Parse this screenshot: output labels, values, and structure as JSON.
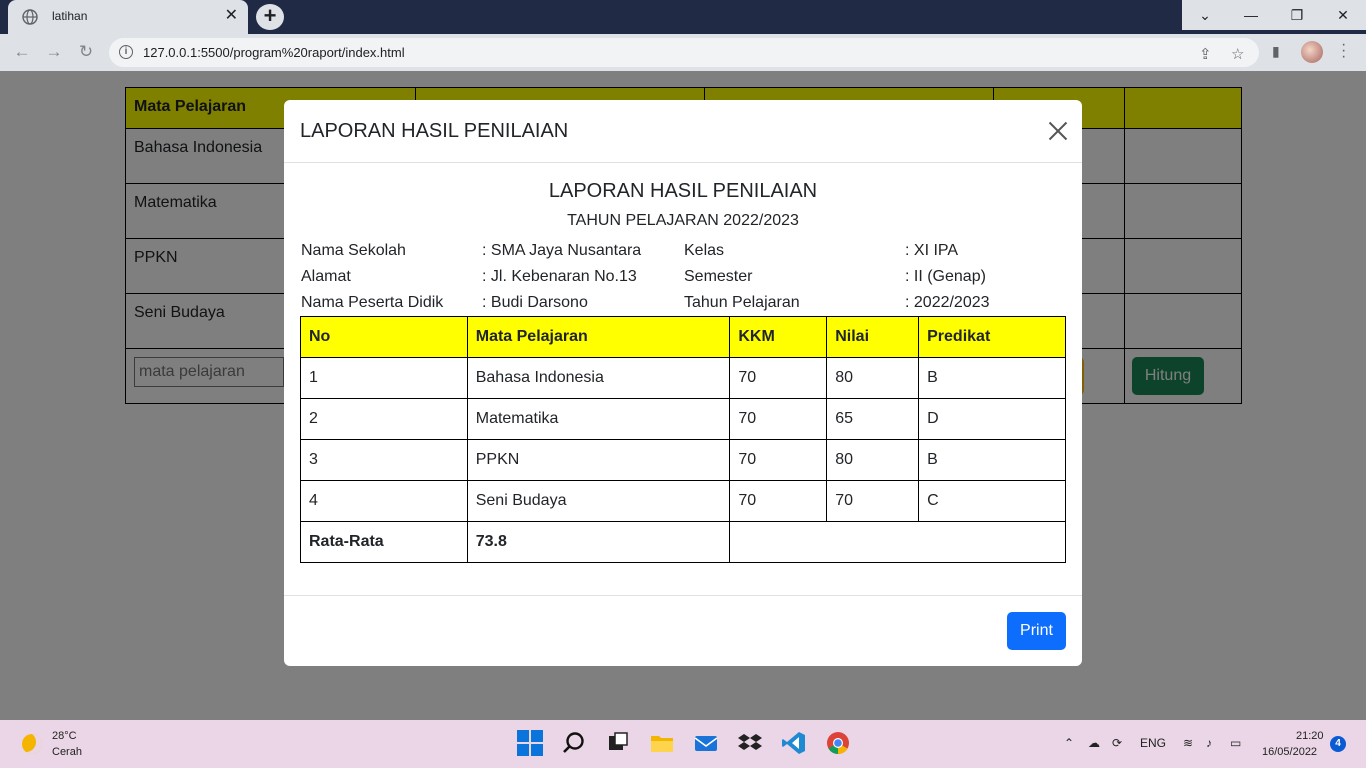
{
  "browser": {
    "tab_title": "latihan",
    "tab_close": "✕",
    "new_tab": "+",
    "url": "127.0.0.1:5500/program%20raport/index.html",
    "win_minimize": "—",
    "win_restore": "❐",
    "win_close": "✕",
    "win_dropdown": "⌄"
  },
  "page": {
    "header_subject": "Mata Pelajaran",
    "subjects": [
      "Bahasa Indonesia",
      "Matematika",
      "PPKN",
      "Seni Budaya"
    ],
    "subject_input_placeholder": "mata pelajaran",
    "hitung_label": "Hitung"
  },
  "modal": {
    "title": "LAPORAN HASIL PENILAIAN",
    "report_title": "LAPORAN HASIL PENILAIAN",
    "report_subtitle": "TAHUN PELAJARAN 2022/2023",
    "info": {
      "nama_sekolah_label": "Nama Sekolah",
      "nama_sekolah_value": ": SMA Jaya Nusantara",
      "alamat_label": "Alamat",
      "alamat_value": ": Jl. Kebenaran No.13",
      "peserta_label": "Nama Peserta Didik",
      "peserta_value": ": Budi Darsono",
      "kelas_label": "Kelas",
      "kelas_value": ": XI IPA",
      "semester_label": "Semester",
      "semester_value": ": II (Genap)",
      "tahun_label": "Tahun Pelajaran",
      "tahun_value": ": 2022/2023"
    },
    "table": {
      "headers": [
        "No",
        "Mata Pelajaran",
        "KKM",
        "Nilai",
        "Predikat"
      ],
      "rows": [
        [
          "1",
          "Bahasa Indonesia",
          "70",
          "80",
          "B"
        ],
        [
          "2",
          "Matematika",
          "70",
          "65",
          "D"
        ],
        [
          "3",
          "PPKN",
          "70",
          "80",
          "B"
        ],
        [
          "4",
          "Seni Budaya",
          "70",
          "70",
          "C"
        ]
      ],
      "average_label": "Rata-Rata",
      "average_value": "73.8"
    },
    "print_label": "Print"
  },
  "taskbar": {
    "temperature": "28°C",
    "weather": "Cerah",
    "language": "ENG",
    "time": "21:20",
    "date": "16/05/2022",
    "notifications": "4"
  },
  "colors": {
    "header_yellow": "#ffff00",
    "print_blue": "#0d6efd",
    "hitung_green": "#198754"
  }
}
